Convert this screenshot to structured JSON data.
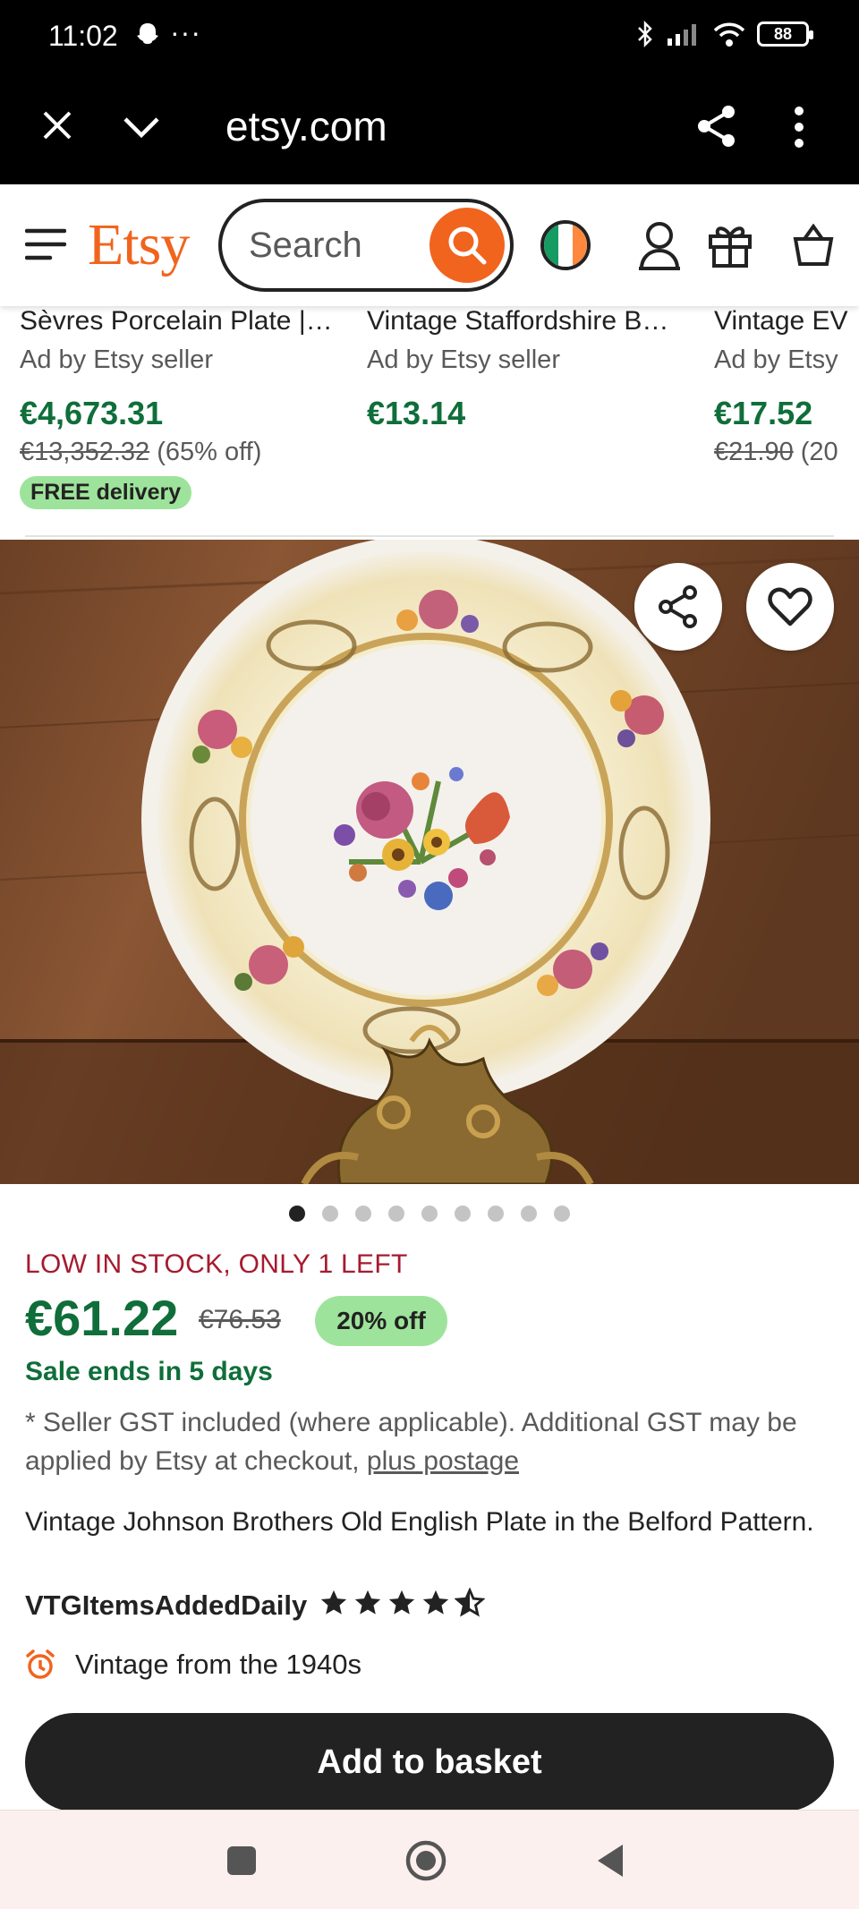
{
  "status_bar": {
    "time": "11:02",
    "more": "···",
    "battery": "88"
  },
  "browser": {
    "url": "etsy.com"
  },
  "header": {
    "logo": "Etsy",
    "search_placeholder": "Search",
    "accent": "#f1641e"
  },
  "listings": [
    {
      "title": "Sèvres Porcelain Plate |…",
      "ad": "Ad by Etsy seller",
      "price": "€4,673.31",
      "old_price": "€13,352.32",
      "discount": "(65% off)",
      "badge": "FREE delivery"
    },
    {
      "title": "Vintage Staffordshire B…",
      "ad": "Ad by Etsy seller",
      "price": "€13.14"
    },
    {
      "title": "Vintage EV",
      "ad": "Ad by Etsy",
      "price": "€17.52",
      "old_price": "€21.90",
      "discount": "(20"
    }
  ],
  "gallery": {
    "image_count": 9,
    "active_index": 0
  },
  "product": {
    "stock": "LOW IN STOCK, ONLY 1 LEFT",
    "price": "€61.22",
    "old_price": "€76.53",
    "discount": "20% off",
    "sale_ends": "Sale ends in 5 days",
    "gst_text": "* Seller GST included (where applicable). Additional GST may be applied by Etsy at checkout, ",
    "gst_link": "plus postage",
    "title": "Vintage Johnson Brothers Old English Plate in the Belford Pattern.",
    "shop": "VTGItemsAddedDaily",
    "rating": 4.5,
    "vintage": "Vintage from the 1940s",
    "add_to_basket": "Add to basket"
  },
  "colors": {
    "price_green": "#0f6e3a",
    "stock_red": "#a61a2e",
    "badge_green": "#9ee39b"
  }
}
